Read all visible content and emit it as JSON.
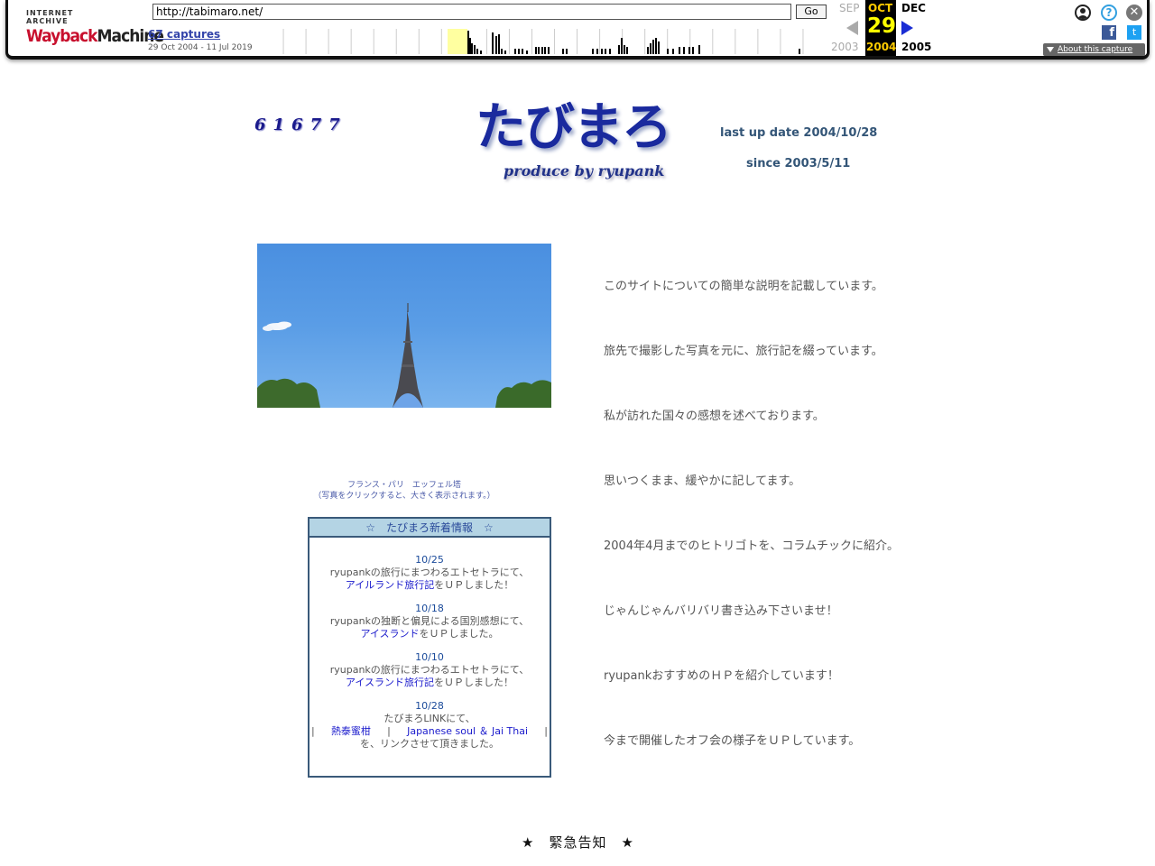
{
  "wayback": {
    "logo_top": "INTERNET ARCHIVE",
    "logo_way": "Wayback",
    "logo_machine": "Machine",
    "url_value": "http://tabimaro.net/",
    "go_label": "Go",
    "captures_label": "67 captures",
    "captures_range": "29 Oct 2004 - 11 Jul 2019",
    "prev_month": "SEP",
    "cur_month": "OCT",
    "next_month": "DEC",
    "cur_day": "29",
    "prev_year": "2003",
    "cur_year": "2004",
    "next_year": "2005",
    "about_capture": "About this capture",
    "help_glyph": "?",
    "close_glyph": "✕",
    "fb_glyph": "f",
    "tw_glyph": "t",
    "icons": [
      "user-icon",
      "help-icon",
      "close-icon",
      "facebook-icon",
      "twitter-icon"
    ],
    "accent": "#ffcc00"
  },
  "header": {
    "counter": "61677",
    "title": "たびまろ",
    "subtitle": "produce by ryupank",
    "last_update": "last up date 2004/10/28",
    "since": "since 2003/5/11"
  },
  "photo": {
    "caption_line1": "フランス・パリ　エッフェル塔",
    "caption_line2": "（写真をクリックすると、大きく表示されます。）"
  },
  "news": {
    "title": "☆　たびまろ新着情報　☆",
    "items": [
      {
        "date": "10/25",
        "line1": "ryupankの旅行にまつわるエトセトラにて、",
        "link": "アイルランド旅行記",
        "line2": "をＵＰしました！"
      },
      {
        "date": "10/18",
        "line1": "ryupankの独断と偏見による国別感想にて、",
        "link": "アイスランド",
        "line2": "をＵＰしました。"
      },
      {
        "date": "10/10",
        "line1": "ryupankの旅行にまつわるエトセトラにて、",
        "link": "アイスランド旅行記",
        "line2": "をＵＰしました！"
      }
    ],
    "link_item": {
      "date": "10/28",
      "line1": "たびまろLINKにて、",
      "link_a": "熱泰蜜柑",
      "link_b": "Japanese soul ＆ Jai Thai",
      "sep": "|",
      "line2": "を、リンクさせて頂きました。"
    }
  },
  "descriptions": [
    "このサイトについての簡単な説明を記載しています。",
    "旅先で撮影した写真を元に、旅行記を綴っています。",
    "私が訪れた国々の感想を述べております。",
    "思いつくまま、緩やかに記してます。",
    "2004年4月までのヒトリゴトを、コラムチックに紹介。",
    "じゃんじゃんバリバリ書き込み下さいませ！",
    "ryupankおすすめのＨＰを紹介しています！",
    "今まで開催したオフ会の様子をＵＰしています。"
  ],
  "urgent": "★　緊急告知　★"
}
